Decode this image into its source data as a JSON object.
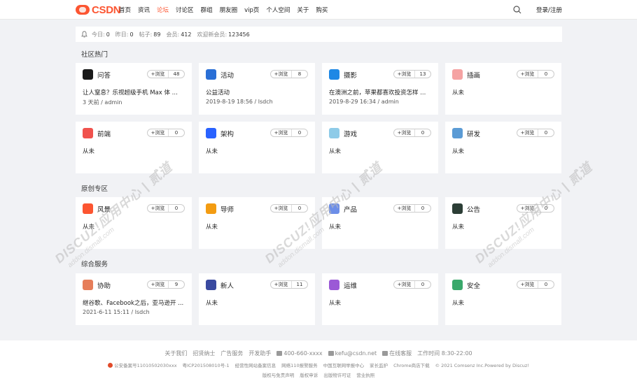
{
  "header": {
    "logo_text": "CSDN",
    "nav": [
      "首页",
      "资讯",
      "论坛",
      "讨论区",
      "群组",
      "朋友圈",
      "vip页",
      "个人空间",
      "关于",
      "购买"
    ],
    "active_index": 2,
    "login_label": "登录/注册"
  },
  "stats": {
    "today_label": "今日:",
    "today": "0",
    "yesterday_label": "昨日:",
    "yesterday": "0",
    "posts_label": "帖子:",
    "posts": "89",
    "members_label": "会员:",
    "members": "412",
    "welcome_label": "欢迎新会员:",
    "welcome": "123456"
  },
  "sections": {
    "hot": "社区热门",
    "original": "原创专区",
    "service": "综合服务"
  },
  "view_label": "+浏览",
  "cards": [
    {
      "name": "问答",
      "count": "48",
      "title": "让人窒息？乐视超级手机 Max 体 ...",
      "meta": "3 天前 / admin",
      "icon": "qa-icon",
      "color": "#1a1a1a"
    },
    {
      "name": "活动",
      "count": "8",
      "title": "公益活动",
      "meta": "2019-8-19 18:56 / lsdch",
      "icon": "activity-icon",
      "color": "#2a6fd6"
    },
    {
      "name": "摄影",
      "count": "13",
      "title": "在澳洲之前，苹果都喜欢投资怎样 ...",
      "meta": "2019-8-29 16:34 / admin",
      "icon": "camera-icon",
      "color": "#1e88e5"
    },
    {
      "name": "插画",
      "count": "0",
      "title": "从未",
      "meta": "",
      "icon": "illustration-icon",
      "color": "#f5a3a3"
    },
    {
      "name": "前端",
      "count": "0",
      "title": "从未",
      "meta": "",
      "icon": "frontend-icon",
      "color": "#f0524d"
    },
    {
      "name": "架构",
      "count": "0",
      "title": "从未",
      "meta": "",
      "icon": "architecture-icon",
      "color": "#2962ff"
    },
    {
      "name": "游戏",
      "count": "0",
      "title": "从未",
      "meta": "",
      "icon": "game-icon",
      "color": "#8ecbe8"
    },
    {
      "name": "研发",
      "count": "0",
      "title": "从未",
      "meta": "",
      "icon": "rnd-icon",
      "color": "#5b9bd5"
    },
    {
      "name": "风景",
      "count": "0",
      "title": "从未",
      "meta": "",
      "icon": "scenery-icon",
      "color": "#fc5531"
    },
    {
      "name": "导师",
      "count": "0",
      "title": "从未",
      "meta": "",
      "icon": "mentor-icon",
      "color": "#f39c12"
    },
    {
      "name": "产品",
      "count": "0",
      "title": "从未",
      "meta": "",
      "icon": "product-icon",
      "color": "#6c8ee8"
    },
    {
      "name": "公告",
      "count": "0",
      "title": "从未",
      "meta": "",
      "icon": "notice-icon",
      "color": "#2c3e36"
    },
    {
      "name": "协助",
      "count": "9",
      "title": "继谷歌、Facebook之后，亚马逊开 ...",
      "meta": "2021-6-11 15:11 / lsdch",
      "icon": "assist-icon",
      "color": "#e67e5a"
    },
    {
      "name": "新人",
      "count": "11",
      "title": "从未",
      "meta": "",
      "icon": "newbie-icon",
      "color": "#3a4aa0"
    },
    {
      "name": "运维",
      "count": "0",
      "title": "从未",
      "meta": "",
      "icon": "ops-icon",
      "color": "#9b59d6"
    },
    {
      "name": "安全",
      "count": "0",
      "title": "从未",
      "meta": "",
      "icon": "security-icon",
      "color": "#3aa86b"
    }
  ],
  "footer": {
    "links": [
      "关于我们",
      "招贤纳士",
      "广告服务",
      "开发助手"
    ],
    "phone": "400-660-xxxx",
    "email": "kefu@csdn.net",
    "online": "在线客服",
    "hours": "工作时间 8:30-22:00",
    "row2": [
      "公安备案号11010502030xxx",
      "粤ICP201508010号-1",
      "经营性网站备案信息",
      "网络110报警服务",
      "中国互联网举报中心",
      "家长监护",
      "Chrome商店下载",
      "© 2021 Comsenz Inc.Powered by Discuz!"
    ],
    "row3": [
      "版权与免责声明",
      "版权申诉",
      "出版物许可证",
      "营业执照"
    ]
  },
  "watermark": {
    "brand": "DISCUZ!应用中心 | 贰道",
    "domain": "addon.dismall.com"
  }
}
